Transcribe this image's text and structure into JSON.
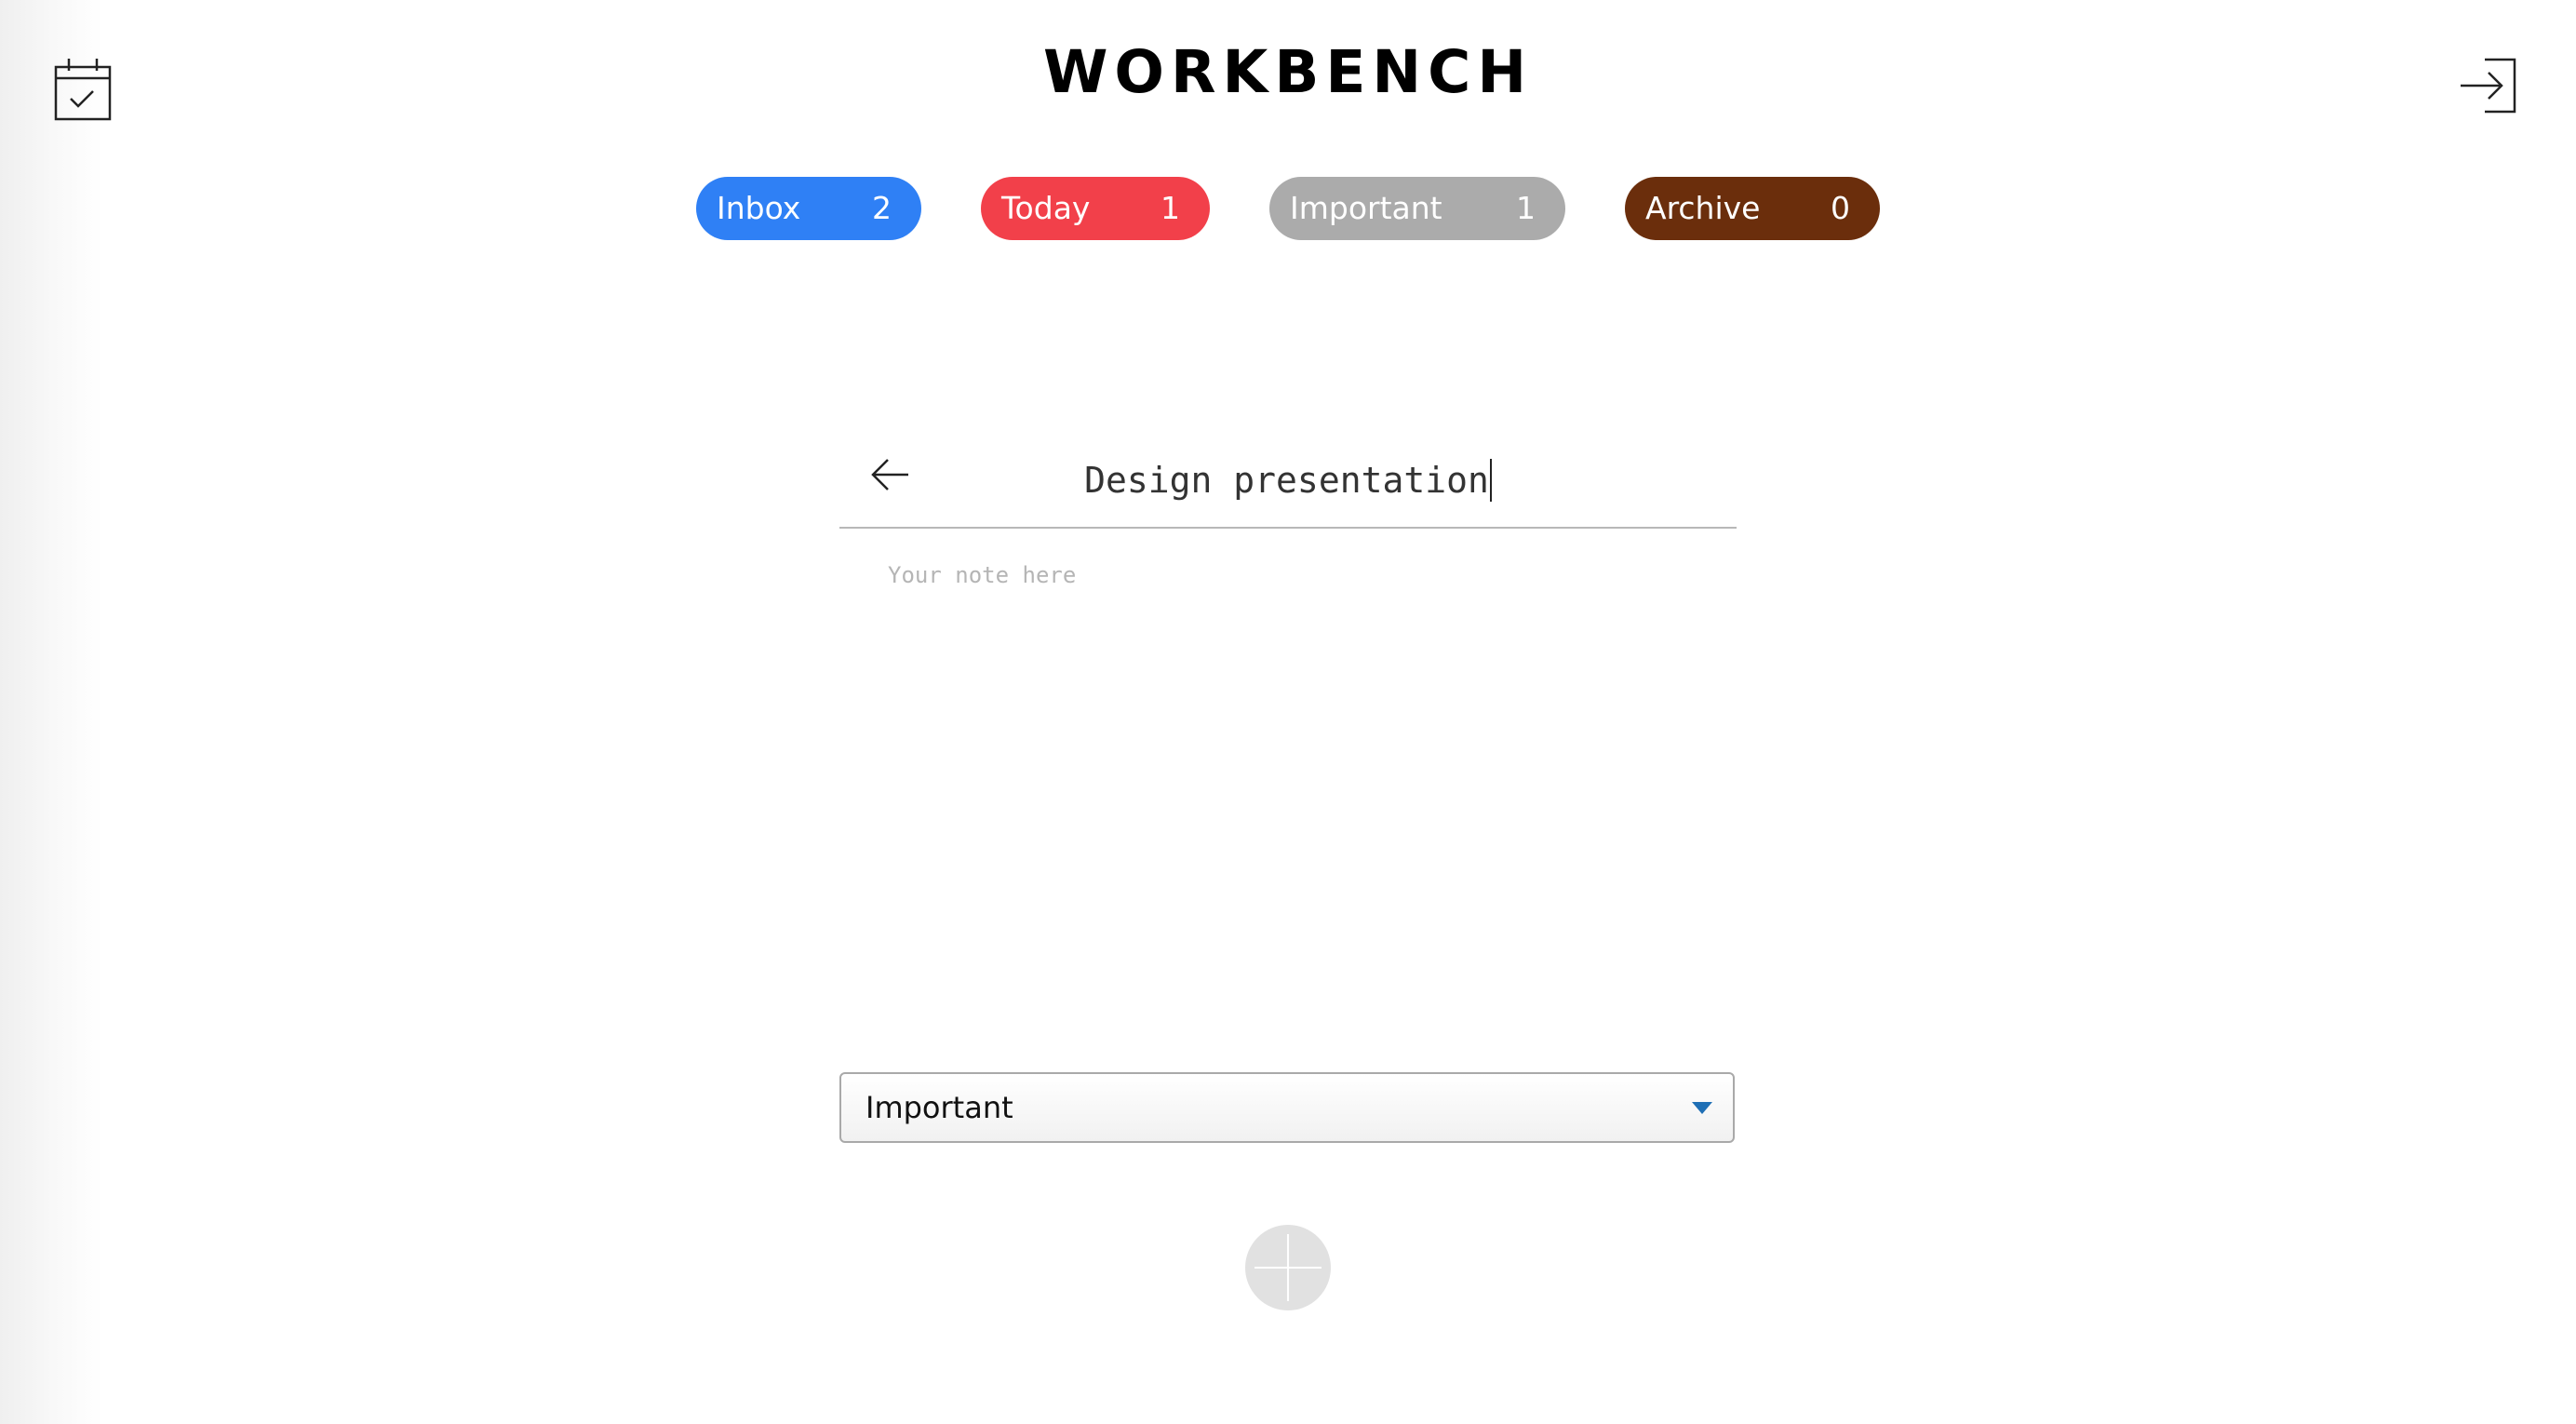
{
  "header": {
    "title": "WORKBENCH",
    "left_icon": "calendar-check-icon",
    "right_icon": "sign-in-icon"
  },
  "filters": [
    {
      "label": "Inbox",
      "count": "2",
      "color": "#2f80f5"
    },
    {
      "label": "Today",
      "count": "1",
      "color": "#f2404a"
    },
    {
      "label": "Important",
      "count": "1",
      "color": "#ababab"
    },
    {
      "label": "Archive",
      "count": "0",
      "color": "#6b2e0c"
    }
  ],
  "editor": {
    "back_icon": "arrow-left-icon",
    "title_value": "Design presentation",
    "note_placeholder": "Your note here",
    "note_value": ""
  },
  "category_select": {
    "selected": "Important",
    "arrow_color": "#1f6fb5"
  },
  "add_button": {
    "icon": "plus-icon"
  }
}
